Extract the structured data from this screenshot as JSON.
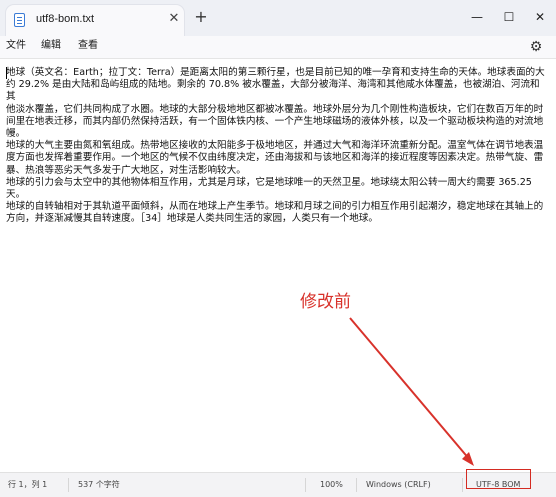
{
  "tab": {
    "title": "utf8-bom.txt",
    "close": "✕",
    "new_tab": "+"
  },
  "window": {
    "minimize": "—",
    "maximize": "☐",
    "close": "✕"
  },
  "menu": {
    "file": "文件",
    "edit": "编辑",
    "view": "查看"
  },
  "editor": {
    "lines": [
      "地球（英文名：Earth；拉丁文：Terra）是距离太阳的第三颗行星，也是目前已知的唯一孕育和支持生命的天体。地球表面的大",
      "约 29.2% 是由大陆和岛屿组成的陆地。剩余的 70.8% 被水覆盖，大部分被海洋、海湾和其他咸水体覆盖，也被湖泊、河流和其",
      "他淡水覆盖，它们共同构成了水圈。地球的大部分极地地区都被冰覆盖。地球外层分为几个刚性构造板块，它们在数百万年的时",
      "间里在地表迁移，而其内部仍然保持活跃，有一个固体铁内核、一个产生地球磁场的液体外核，以及一个驱动板块构造的对流地",
      "幔。",
      "地球的大气主要由氮和氧组成。热带地区接收的太阳能多于极地地区，并通过大气和海洋环流重新分配。温室气体在调节地表温",
      "度方面也发挥着重要作用。一个地区的气候不仅由纬度决定，还由海拔和与该地区和海洋的接近程度等因素决定。热带气旋、雷",
      "暴、热浪等恶劣天气多发于广大地区，对生活影响较大。",
      "地球的引力会与太空中的其他物体相互作用，尤其是月球，它是地球唯一的天然卫星。地球绕太阳公转一周大约需要 365.25 天。",
      "地球的自转轴相对于其轨道平面倾斜，从而在地球上产生季节。地球和月球之间的引力相互作用引起潮汐，稳定地球在其轴上的",
      "方向，并逐渐减慢其自转速度。［34］地球是人类共同生活的家园，人类只有一个地球。"
    ]
  },
  "annotation": "修改前",
  "status": {
    "position": "行 1，列 1",
    "chars": "537 个字符",
    "zoom": "100%",
    "line_ending": "Windows (CRLF)",
    "encoding": "UTF-8 BOM"
  },
  "colors": {
    "annotation": "#d8322b",
    "titlebar": "#eef0f5"
  }
}
